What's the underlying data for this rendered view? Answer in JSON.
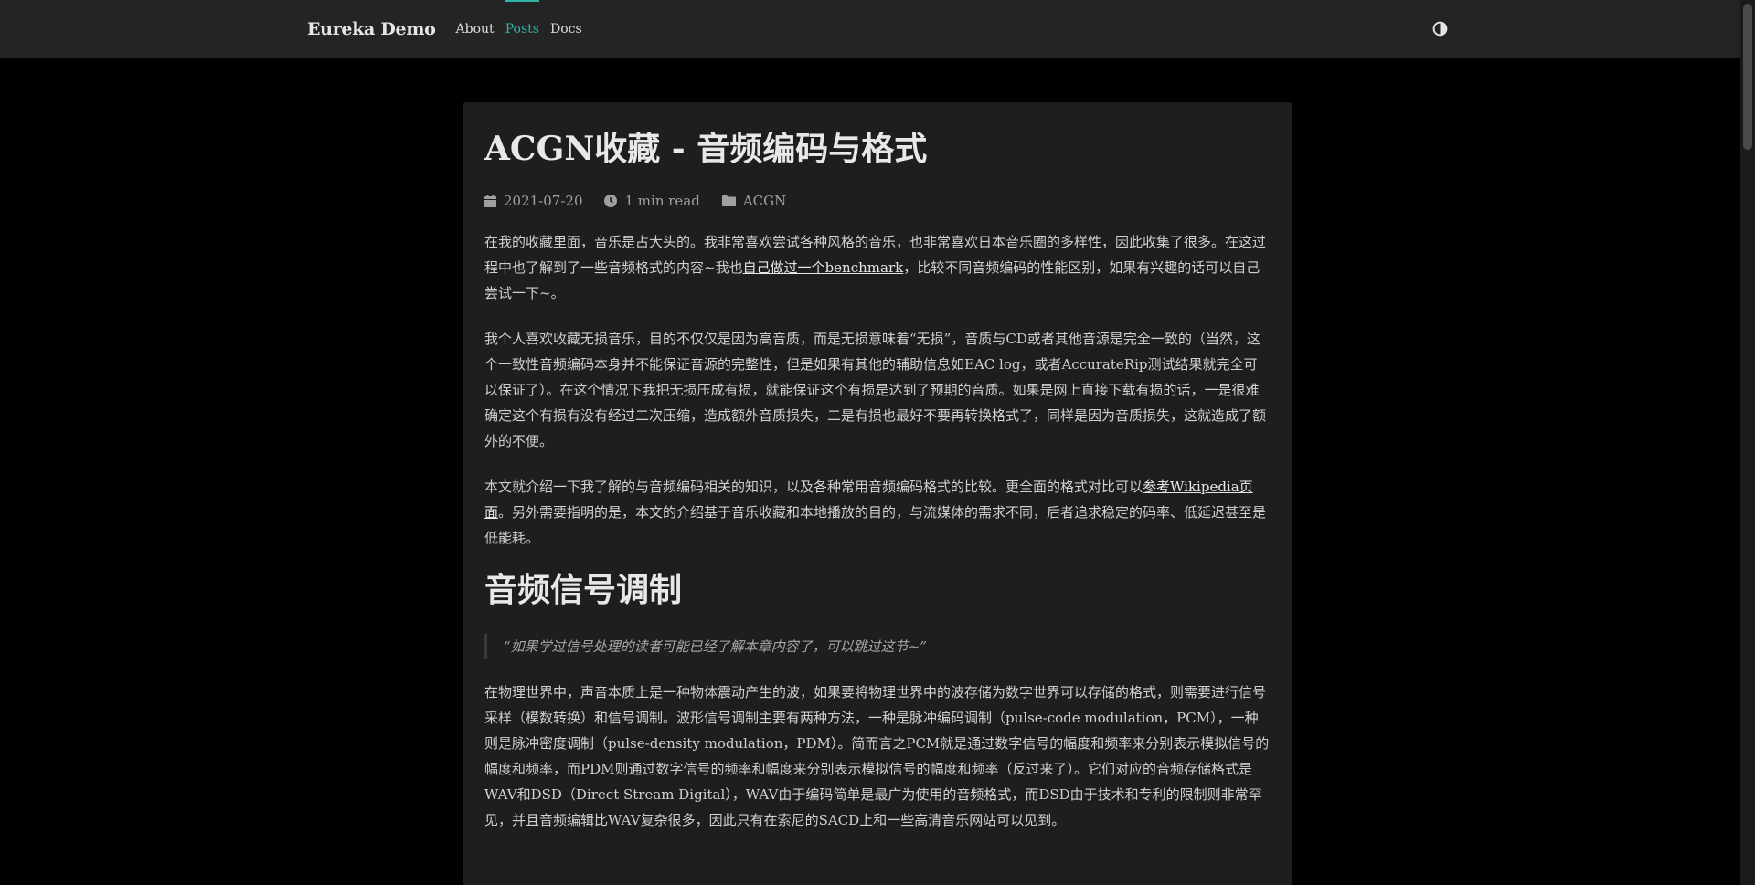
{
  "nav": {
    "brand": "Eureka Demo",
    "links": [
      "About",
      "Posts",
      "Docs"
    ],
    "active": "Posts",
    "theme_toggle_icon": "contrast-icon",
    "accent_color": "#2fb5a5"
  },
  "post": {
    "title": "ACGN收藏 - 音频编码与格式",
    "date": "2021-07-20",
    "read_time": "1 min read",
    "category": "ACGN",
    "p1_a": "在我的收藏里面，音乐是占大头的。我非常喜欢尝试各种风格的音乐，也非常喜欢日本音乐圈的多样性，因此收集了很多。在这过程中也了解到了一些音频格式的内容~我也",
    "p1_link": "自己做过一个benchmark",
    "p1_b": "，比较不同音频编码的性能区别，如果有兴趣的话可以自己尝试一下~。",
    "p2": "我个人喜欢收藏无损音乐，目的不仅仅是因为高音质，而是无损意味着“无损”，音质与CD或者其他音源是完全一致的（当然，这个一致性音频编码本身并不能保证音源的完整性，但是如果有其他的辅助信息如EAC log，或者AccurateRip测试结果就完全可以保证了）。在这个情况下我把无损压成有损，就能保证这个有损是达到了预期的音质。如果是网上直接下载有损的话，一是很难确定这个有损有没有经过二次压缩，造成额外音质损失，二是有损也最好不要再转换格式了，同样是因为音质损失，这就造成了额外的不便。",
    "p3_a": "本文就介绍一下我了解的与音频编码相关的知识，以及各种常用音频编码格式的比较。更全面的格式对比可以",
    "p3_link": "参考Wikipedia页面",
    "p3_b": "。另外需要指明的是，本文的介绍基于音乐收藏和本地播放的目的，与流媒体的需求不同，后者追求稳定的码率、低延迟甚至是低能耗。",
    "heading1": "音频信号调制",
    "quote": "“如果学过信号处理的读者可能已经了解本章内容了，可以跳过这节~”",
    "p4": "在物理世界中，声音本质上是一种物体震动产生的波，如果要将物理世界中的波存储为数字世界可以存储的格式，则需要进行信号采样（模数转换）和信号调制。波形信号调制主要有两种方法，一种是脉冲编码调制（pulse-code modulation，PCM），一种则是脉冲密度调制（pulse-density modulation，PDM）。简而言之PCM就是通过数字信号的幅度和频率来分别表示模拟信号的幅度和频率，而PDM则通过数字信号的频率和幅度来分别表示模拟信号的幅度和频率（反过来了）。它们对应的音频存储格式是WAV和DSD（Direct Stream Digital），WAV由于编码简单是最广为使用的音频格式，而DSD由于技术和专利的限制则非常罕见，并且音频编辑比WAV复杂很多，因此只有在索尼的SACD上和一些高清音乐网站可以见到。"
  }
}
